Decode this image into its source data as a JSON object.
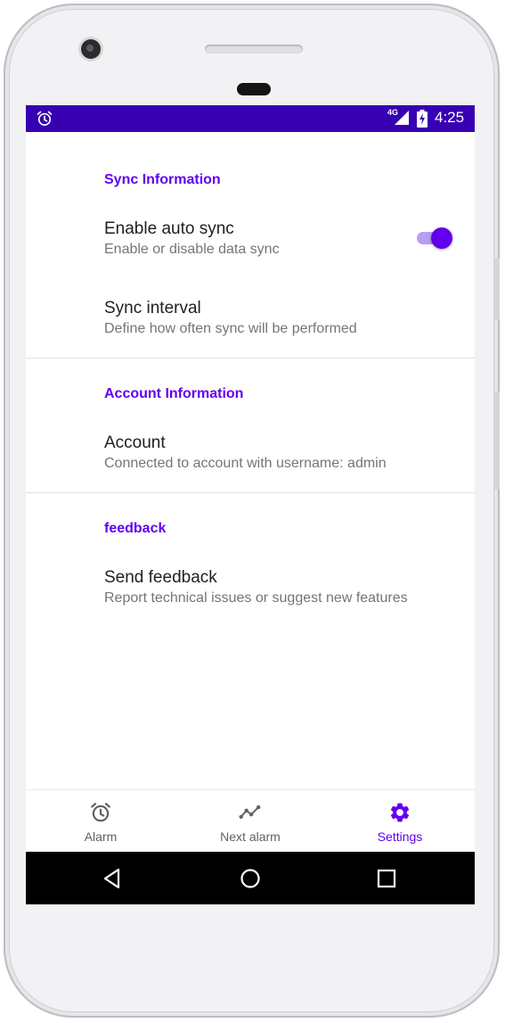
{
  "status_bar": {
    "network": "4G",
    "time": "4:25",
    "alarm_icon": "alarm-clock-icon",
    "signal_icon": "signal-icon",
    "battery_icon": "battery-charging-icon",
    "background_color": "#3700b3"
  },
  "settings": {
    "sections": [
      {
        "title": "Sync Information",
        "items": [
          {
            "title": "Enable auto sync",
            "summary": "Enable or disable data sync",
            "switch_on": true
          },
          {
            "title": "Sync interval",
            "summary": "Define how often sync will be performed"
          }
        ]
      },
      {
        "title": "Account Information",
        "items": [
          {
            "title": "Account",
            "summary": "Connected to account with username: admin"
          }
        ]
      },
      {
        "title": "feedback",
        "items": [
          {
            "title": "Send feedback",
            "summary": "Report technical issues or suggest new features"
          }
        ]
      }
    ]
  },
  "bottom_nav": {
    "items": [
      {
        "label": "Alarm",
        "icon": "alarm-clock-icon",
        "active": false
      },
      {
        "label": "Next alarm",
        "icon": "timeline-icon",
        "active": false
      },
      {
        "label": "Settings",
        "icon": "gear-icon",
        "active": true
      }
    ]
  },
  "system_nav": {
    "back_icon": "back-triangle-icon",
    "home_icon": "home-circle-icon",
    "recents_icon": "recents-square-icon"
  },
  "colors": {
    "accent": "#6200ee",
    "status_bar": "#3700b3",
    "primary_text": "#202124",
    "secondary_text": "#757575"
  }
}
